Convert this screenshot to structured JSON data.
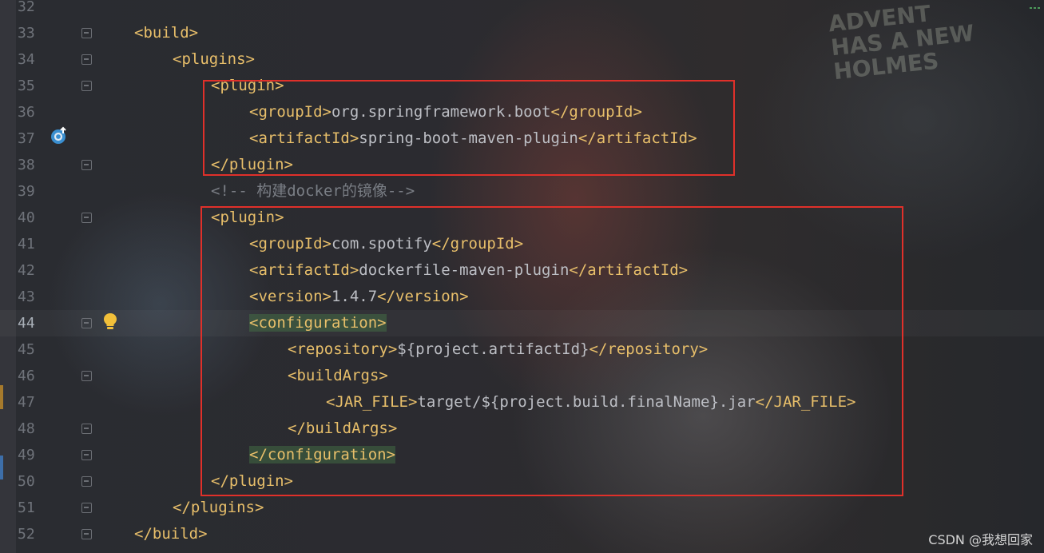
{
  "editor": {
    "lines": [
      {
        "num": "32",
        "indent": 0,
        "parts": []
      },
      {
        "num": "33",
        "indent": 1,
        "parts": [
          {
            "t": "tag",
            "v": "<build>"
          }
        ]
      },
      {
        "num": "34",
        "indent": 2,
        "parts": [
          {
            "t": "tag",
            "v": "<plugins>"
          }
        ]
      },
      {
        "num": "35",
        "indent": 3,
        "parts": [
          {
            "t": "tag",
            "v": "<plugin>"
          }
        ]
      },
      {
        "num": "36",
        "indent": 4,
        "parts": [
          {
            "t": "tag",
            "v": "<groupId>"
          },
          {
            "t": "txt",
            "v": "org.springframework.boot"
          },
          {
            "t": "tag",
            "v": "</groupId>"
          }
        ]
      },
      {
        "num": "37",
        "indent": 4,
        "parts": [
          {
            "t": "tag",
            "v": "<artifactId>"
          },
          {
            "t": "txt",
            "v": "spring-boot-maven-plugin"
          },
          {
            "t": "tag",
            "v": "</artifactId>"
          }
        ]
      },
      {
        "num": "38",
        "indent": 3,
        "parts": [
          {
            "t": "tag",
            "v": "</plugin>"
          }
        ]
      },
      {
        "num": "39",
        "indent": 3,
        "parts": [
          {
            "t": "cmt",
            "v": "<!-- 构建docker的镜像-->"
          }
        ]
      },
      {
        "num": "40",
        "indent": 3,
        "parts": [
          {
            "t": "tag",
            "v": "<plugin>"
          }
        ]
      },
      {
        "num": "41",
        "indent": 4,
        "parts": [
          {
            "t": "tag",
            "v": "<groupId>"
          },
          {
            "t": "txt",
            "v": "com.spotify"
          },
          {
            "t": "tag",
            "v": "</groupId>"
          }
        ]
      },
      {
        "num": "42",
        "indent": 4,
        "parts": [
          {
            "t": "tag",
            "v": "<artifactId>"
          },
          {
            "t": "txt",
            "v": "dockerfile-maven-plugin"
          },
          {
            "t": "tag",
            "v": "</artifactId>"
          }
        ]
      },
      {
        "num": "43",
        "indent": 4,
        "parts": [
          {
            "t": "tag",
            "v": "<version>"
          },
          {
            "t": "txt",
            "v": "1.4.7"
          },
          {
            "t": "tag",
            "v": "</version>"
          }
        ]
      },
      {
        "num": "44",
        "indent": 4,
        "current": true,
        "parts": [
          {
            "t": "tag hl",
            "v": "<configuration>"
          }
        ]
      },
      {
        "num": "45",
        "indent": 5,
        "parts": [
          {
            "t": "tag",
            "v": "<repository>"
          },
          {
            "t": "txt",
            "v": "${project.artifactId}"
          },
          {
            "t": "tag",
            "v": "</repository>"
          }
        ]
      },
      {
        "num": "46",
        "indent": 5,
        "parts": [
          {
            "t": "tag",
            "v": "<buildArgs>"
          }
        ]
      },
      {
        "num": "47",
        "indent": 6,
        "parts": [
          {
            "t": "tag",
            "v": "<JAR_FILE>"
          },
          {
            "t": "txt",
            "v": "target/${project.build.finalName}.jar"
          },
          {
            "t": "tag",
            "v": "</JAR_FILE>"
          }
        ]
      },
      {
        "num": "48",
        "indent": 5,
        "parts": [
          {
            "t": "tag",
            "v": "</buildArgs>"
          }
        ]
      },
      {
        "num": "49",
        "indent": 4,
        "parts": [
          {
            "t": "tag hl",
            "v": "</configuration>"
          }
        ]
      },
      {
        "num": "50",
        "indent": 3,
        "parts": [
          {
            "t": "tag",
            "v": "</plugin>"
          }
        ]
      },
      {
        "num": "51",
        "indent": 2,
        "parts": [
          {
            "t": "tag",
            "v": "</plugins>"
          }
        ]
      },
      {
        "num": "52",
        "indent": 1,
        "parts": [
          {
            "t": "tag",
            "v": "</build>"
          }
        ]
      }
    ],
    "fold_lines": [
      "33",
      "34",
      "35",
      "38",
      "40",
      "44",
      "46",
      "48",
      "49",
      "50",
      "51",
      "52"
    ]
  },
  "gutter_icons": {
    "run": {
      "line": "37",
      "icon": "run-config-icon"
    },
    "bulb": {
      "line": "44",
      "icon": "lightbulb-icon"
    }
  },
  "background": {
    "poster_text": "ADVENT\nHAS A NEW\nHOLMES"
  },
  "watermark": "CSDN @我想回家",
  "colors": {
    "tag": "#e8bf6a",
    "text": "#bcbec4",
    "comment": "#7a7e85",
    "highlight_box": "#e0302a"
  }
}
